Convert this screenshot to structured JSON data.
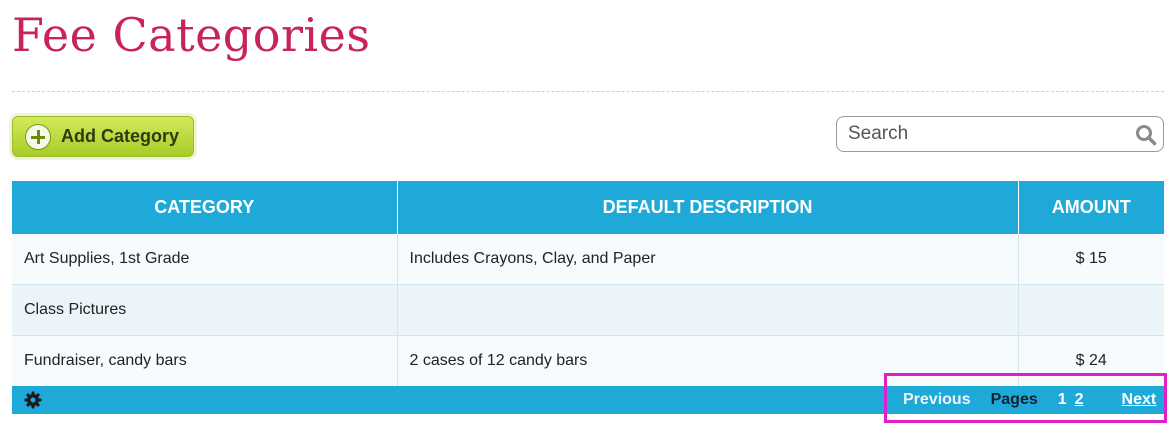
{
  "page": {
    "title": "Fee Categories"
  },
  "toolbar": {
    "add_label": "Add Category"
  },
  "search": {
    "placeholder": "Search"
  },
  "table": {
    "headers": [
      "CATEGORY",
      "DEFAULT DESCRIPTION",
      "AMOUNT"
    ],
    "rows": [
      {
        "category": "Art Supplies, 1st Grade",
        "description": "Includes Crayons, Clay, and Paper",
        "amount": "$ 15"
      },
      {
        "category": "Class Pictures",
        "description": "",
        "amount": ""
      },
      {
        "category": "Fundraiser, candy bars",
        "description": "2 cases of 12 candy bars",
        "amount": "$ 24"
      }
    ]
  },
  "pagination": {
    "previous": "Previous",
    "pages_label": "Pages",
    "pages": [
      "1",
      "2"
    ],
    "next": "Next"
  },
  "colors": {
    "title": "#c8235a",
    "header_bg": "#1ea9d8",
    "add_button": "#b5d934",
    "highlight_border": "#e21ec8"
  },
  "icons": {
    "add": "plus-circle-icon",
    "search": "magnifier-icon",
    "settings": "gear-icon"
  }
}
